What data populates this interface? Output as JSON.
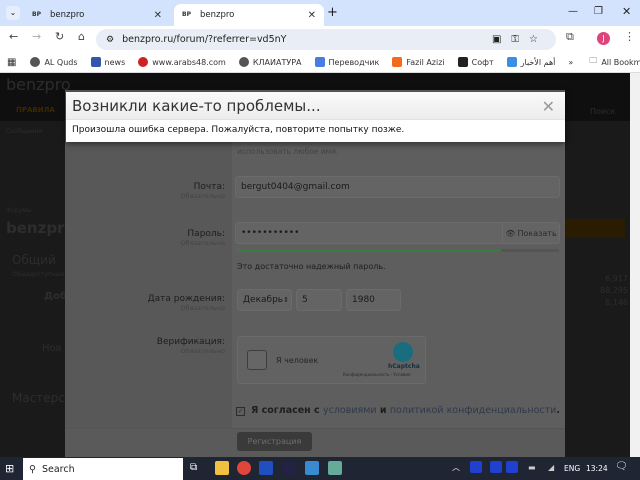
{
  "browser": {
    "tabs": [
      {
        "favicon": "BP",
        "title": "benzpro"
      },
      {
        "favicon": "BP",
        "title": "benzpro",
        "active": true
      }
    ],
    "url": "benzpro.ru/forum/?referrer=vd5nY",
    "profile_initial": "J",
    "bookmarks": [
      {
        "label": "AL Quds",
        "color": "#555"
      },
      {
        "label": "news",
        "color": "#3355aa"
      },
      {
        "label": "www.arabs48.com",
        "color": "#cc2222"
      },
      {
        "label": "КЛАИАТУРА",
        "color": "#555"
      },
      {
        "label": "Переводчик",
        "color": "#4a7be0"
      },
      {
        "label": "Fazil Azizi",
        "color": "#f26a1b"
      },
      {
        "label": "Софт",
        "color": "#222"
      },
      {
        "label": "أهم الأخبار",
        "color": "#3c8ee0"
      }
    ],
    "all_bookmarks": "All Bookmarks"
  },
  "background": {
    "site_title": "benzpro",
    "nav": "ПРАВИЛА",
    "sub": "Сообщения",
    "breadcrumb": "Форумы",
    "heading": "benzpro",
    "section1": "Общий",
    "section1_sub": "Общедоступные",
    "forum1": "Добр",
    "forum2": "Нов",
    "section2": "Мастерс",
    "search": "Поиск",
    "stats": [
      "6,917",
      "88,295",
      "8,146"
    ]
  },
  "error_dialog": {
    "title": "Возникли какие-то проблемы...",
    "message": "Произошла ошибка сервера. Пожалуйста, повторите попытку позже."
  },
  "form": {
    "hint": "использовать любое имя.",
    "required": "Обязательно",
    "email_label": "Почта:",
    "email_value": "bergut0404@gmail.com",
    "password_label": "Пароль:",
    "password_value": "•••••••••••",
    "show_label": "Показать",
    "password_strength": 0.82,
    "strength_color": "#3d7a3d",
    "strength_text": "Это достаточно надежный пароль.",
    "dob_label": "Дата рождения:",
    "month": "Декабрь",
    "day": "5",
    "year": "1980",
    "verify_label": "Верификация:",
    "captcha_label": "Я человек",
    "captcha_brand": "hCaptcha",
    "captcha_links": "Конфиденциальность - Условия",
    "agree_pre": "Я согласен с ",
    "agree_link1": "условиями",
    "agree_mid": " и ",
    "agree_link2": "политикой конфиденциальности",
    "register": "Регистрация"
  },
  "taskbar": {
    "search": "Search",
    "lang": "ENG",
    "time": "13:24"
  }
}
